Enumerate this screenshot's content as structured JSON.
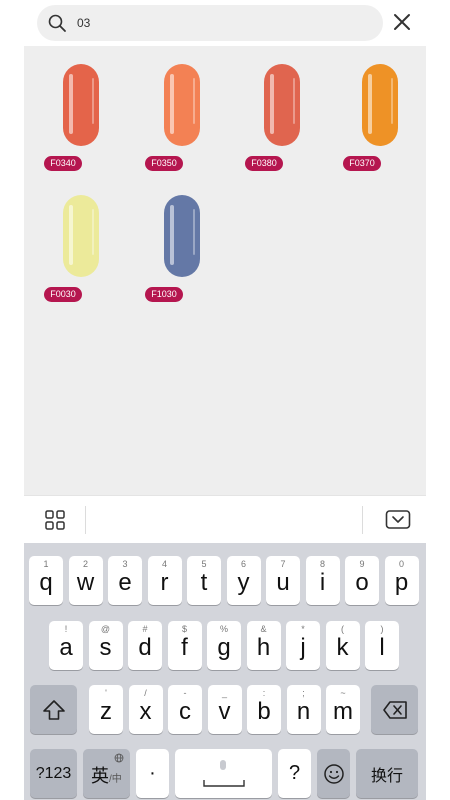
{
  "search": {
    "query": "03",
    "search_icon": "search-icon",
    "close_icon": "close-icon"
  },
  "results": [
    {
      "code": "F0340",
      "color": "#e4644a"
    },
    {
      "code": "F0350",
      "color": "#f38154"
    },
    {
      "code": "F0380",
      "color": "#e0654f"
    },
    {
      "code": "F0370",
      "color": "#ee9226"
    },
    {
      "code": "F0030",
      "color": "#ecea9a"
    },
    {
      "code": "F1030",
      "color": "#6478a6"
    }
  ],
  "badge_color": "#b5164f",
  "keyboard_toolbar": {
    "grid_icon": "grid-icon",
    "collapse_icon": "keyboard-collapse-icon"
  },
  "keyboard": {
    "row1": [
      {
        "hint": "1",
        "key": "q"
      },
      {
        "hint": "2",
        "key": "w"
      },
      {
        "hint": "3",
        "key": "e"
      },
      {
        "hint": "4",
        "key": "r"
      },
      {
        "hint": "5",
        "key": "t"
      },
      {
        "hint": "6",
        "key": "y"
      },
      {
        "hint": "7",
        "key": "u"
      },
      {
        "hint": "8",
        "key": "i"
      },
      {
        "hint": "9",
        "key": "o"
      },
      {
        "hint": "0",
        "key": "p"
      }
    ],
    "row2": [
      {
        "hint": "!",
        "key": "a"
      },
      {
        "hint": "@",
        "key": "s"
      },
      {
        "hint": "#",
        "key": "d"
      },
      {
        "hint": "$",
        "key": "f"
      },
      {
        "hint": "%",
        "key": "g"
      },
      {
        "hint": "&",
        "key": "h"
      },
      {
        "hint": "*",
        "key": "j"
      },
      {
        "hint": "(",
        "key": "k"
      },
      {
        "hint": ")",
        "key": "l"
      }
    ],
    "row3": [
      {
        "hint": "'",
        "key": "z"
      },
      {
        "hint": "/",
        "key": "x"
      },
      {
        "hint": "-",
        "key": "c"
      },
      {
        "hint": "_",
        "key": "v"
      },
      {
        "hint": ":",
        "key": "b"
      },
      {
        "hint": ";",
        "key": "n"
      },
      {
        "hint": "~",
        "key": "m"
      }
    ],
    "shift_icon": "shift-icon",
    "delete_icon": "backspace-icon",
    "num_key": "?123",
    "lang_key": "英",
    "lang_sub": "/中",
    "lang_icon": "globe-icon",
    "dot_key": "·",
    "space_icon": "microphone-icon",
    "question_key": "?",
    "emoji_icon": "emoji-icon",
    "enter_key": "换行"
  }
}
